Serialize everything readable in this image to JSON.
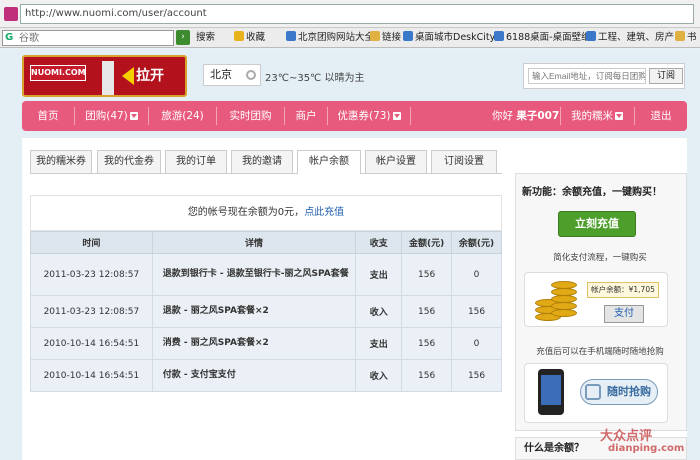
{
  "browser": {
    "url": "http://www.nuomi.com/user/account",
    "search_placeholder": "谷歌",
    "search_button": "搜索",
    "toolbar": [
      {
        "label": "收藏",
        "icon": "star-icon"
      },
      {
        "label": "北京团购网站大全",
        "icon": "page-icon"
      },
      {
        "label": "链接",
        "icon": "folder-icon"
      },
      {
        "label": "桌面城市DeskCity.c",
        "icon": "page-icon"
      },
      {
        "label": "6188桌面-桌面壁纸",
        "icon": "page-icon"
      },
      {
        "label": "工程、建筑、房产",
        "icon": "page-icon"
      },
      {
        "label": "书",
        "icon": "folder-icon"
      }
    ]
  },
  "header": {
    "logo_brand": "NUOMI.COM",
    "logo_action": "拉开",
    "city": "北京",
    "weather": "23℃~35℃ 以晴为主",
    "subscribe_placeholder": "输入Email地址，订阅每日团购",
    "subscribe_button": "订阅"
  },
  "nav": {
    "items": [
      "首页",
      "团购(47)",
      "旅游(24)",
      "实时团购",
      "商户",
      "优惠券(73)"
    ],
    "greeting": "你好",
    "username": "果子007",
    "my_nuomi": "我的糯米",
    "logout": "退出"
  },
  "tabs": [
    "我的糯米券",
    "我的代金券",
    "我的订单",
    "我的邀请",
    "帐户余额",
    "帐户设置",
    "订阅设置"
  ],
  "active_tab": "帐户余额",
  "balance": {
    "message": "您的帐号现在余额为0元，",
    "link": "点此充值"
  },
  "table": {
    "headers": [
      "时间",
      "详情",
      "收支",
      "金额(元)",
      "余额(元)"
    ],
    "rows": [
      {
        "time": "2011-03-23 12:08:57",
        "detail": "退款到银行卡 - 退款至银行卡-丽之风SPA套餐",
        "type": "支出",
        "amount": "156",
        "balance": "0"
      },
      {
        "time": "2011-03-23 12:08:57",
        "detail": "退款 - 丽之风SPA套餐×2",
        "type": "收入",
        "amount": "156",
        "balance": "156"
      },
      {
        "time": "2010-10-14 16:54:51",
        "detail": "消费 - 丽之风SPA套餐×2",
        "type": "支出",
        "amount": "156",
        "balance": "0"
      },
      {
        "time": "2010-10-14 16:54:51",
        "detail": "付款 - 支付宝支付",
        "type": "收入",
        "amount": "156",
        "balance": "156"
      }
    ]
  },
  "sidebar": {
    "title": "新功能：余额充值，一键购买！",
    "recharge_button": "立刻充值",
    "flow_text": "简化支付流程，一键购买",
    "balance_card": "帐户余额：¥1,705",
    "pay_button": "支付",
    "mobile_text": "充值后可以在手机端随时随地抢购",
    "buy_button": "随时抢购",
    "faq_title": "什么是余额？"
  },
  "watermark": {
    "brand": "大众点评",
    "domain": "dianping.com"
  },
  "colors": {
    "nav_pink": "#e85a7d",
    "recharge_green": "#4e9e2b",
    "out_red": "#d22",
    "in_green": "#3a8a2a"
  }
}
